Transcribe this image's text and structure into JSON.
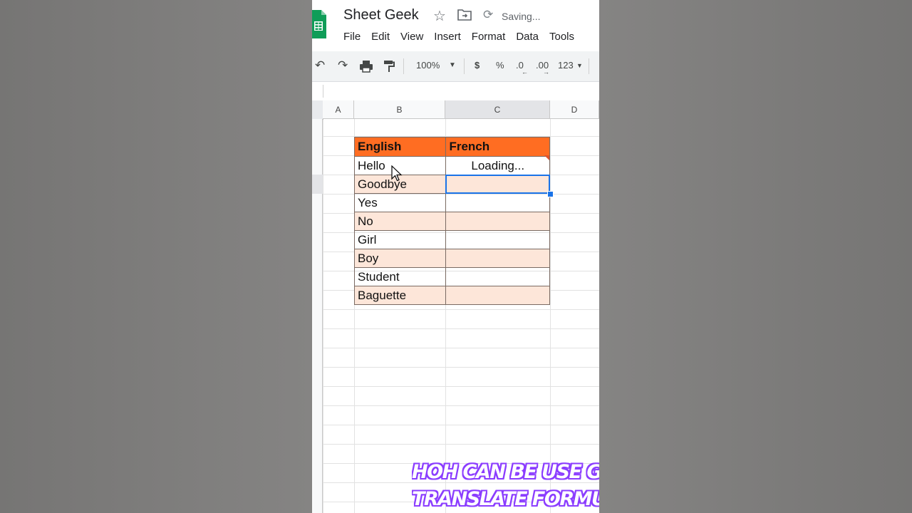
{
  "app": {
    "title": "Sheet Geek",
    "status": "Saving...",
    "menu": [
      "File",
      "Edit",
      "View",
      "Insert",
      "Format",
      "Data",
      "Tools"
    ]
  },
  "toolbar": {
    "zoom": "100%",
    "currency": "$",
    "percent": "%",
    "decrease_decimal": ".0",
    "increase_decimal": ".00",
    "more_formats": "123"
  },
  "columns": [
    "A",
    "B",
    "C",
    "D"
  ],
  "table": {
    "headers": [
      "English",
      "French"
    ],
    "rows": [
      [
        "Hello",
        "Loading..."
      ],
      [
        "Goodbye",
        ""
      ],
      [
        "Yes",
        ""
      ],
      [
        "No",
        ""
      ],
      [
        "Girl",
        ""
      ],
      [
        "Boy",
        ""
      ],
      [
        "Student",
        ""
      ],
      [
        "Baguette",
        ""
      ]
    ]
  },
  "caption": {
    "line1": "HOH CAN BE USE GOOG",
    "line2": "TRANSLATE FORMULA"
  },
  "colors": {
    "header_fill": "#ff6d22",
    "alt_row_fill": "#fde6d9",
    "selection": "#1a73e8",
    "sheets_green": "#0f9d58",
    "caption_outline": "#8b3dff"
  }
}
